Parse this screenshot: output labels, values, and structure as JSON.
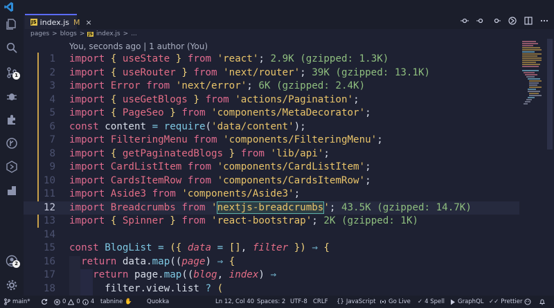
{
  "tab": {
    "label": "index.js",
    "modified": "M",
    "close": "×",
    "js": "JS"
  },
  "breadcrumb": {
    "part1": "pages",
    "part2": "blogs",
    "file": "index.js",
    "more": "...",
    "sep": ">"
  },
  "blame": "You, seconds ago | 1 author (You)",
  "activity": {
    "scm_badge": "1",
    "account_badge": "2"
  },
  "code": {
    "lines": [
      {
        "n": "1"
      },
      {
        "n": "2"
      },
      {
        "n": "3"
      },
      {
        "n": "4"
      },
      {
        "n": "5"
      },
      {
        "n": "6"
      },
      {
        "n": "7"
      },
      {
        "n": "8"
      },
      {
        "n": "9"
      },
      {
        "n": "10"
      },
      {
        "n": "11"
      },
      {
        "n": "12"
      },
      {
        "n": "13"
      },
      {
        "n": "14"
      },
      {
        "n": "15"
      },
      {
        "n": "16"
      },
      {
        "n": "17"
      },
      {
        "n": "18"
      }
    ],
    "hints": {
      "l1": "2.9K (gzipped: 1.3K)",
      "l2": "39K (gzipped: 13.1K)",
      "l3": "6K (gzipped: 2.4K)",
      "l12": "43.5K (gzipped: 14.7K)",
      "l13": "2K (gzipped: 1K)"
    }
  },
  "status": {
    "branch": "main*",
    "errors": "0",
    "warnings": "0",
    "info": "4",
    "tabnine": "tabnine",
    "quokka": "Quokka",
    "position": "Ln 12, Col 40",
    "spaces": "Spaces: 2",
    "encoding": "UTF-8",
    "eol": "CRLF",
    "language": "JavaScript",
    "golive": "Go Live",
    "spell": "4 Spell",
    "graphql": "GraphQL",
    "prettier": "Prettier"
  }
}
